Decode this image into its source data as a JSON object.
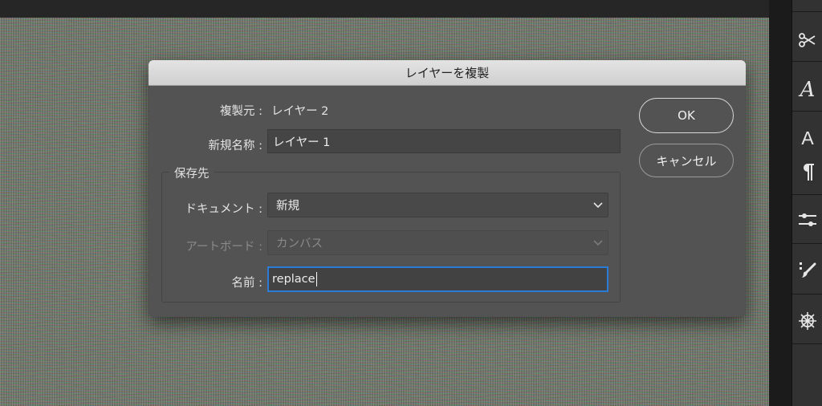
{
  "dialog": {
    "title": "レイヤーを複製",
    "source_label": "複製元 :",
    "source_value": "レイヤー 2",
    "new_name_label": "新規名称 :",
    "new_name_value": "レイヤー 1",
    "destination_group": "保存先",
    "document_label": "ドキュメント :",
    "document_value": "新規",
    "artboard_label": "アートボード :",
    "artboard_value": "カンバス",
    "name_label": "名前 :",
    "name_value": "replace",
    "ok_label": "OK",
    "cancel_label": "キャンセル"
  },
  "tools": {
    "type_char_a": "A",
    "type_char_b": "A"
  },
  "colors": {
    "focus_ring": "#2a7cd6",
    "dialog_bg": "#535353",
    "titlebar_bg": "#d8d8d8"
  }
}
